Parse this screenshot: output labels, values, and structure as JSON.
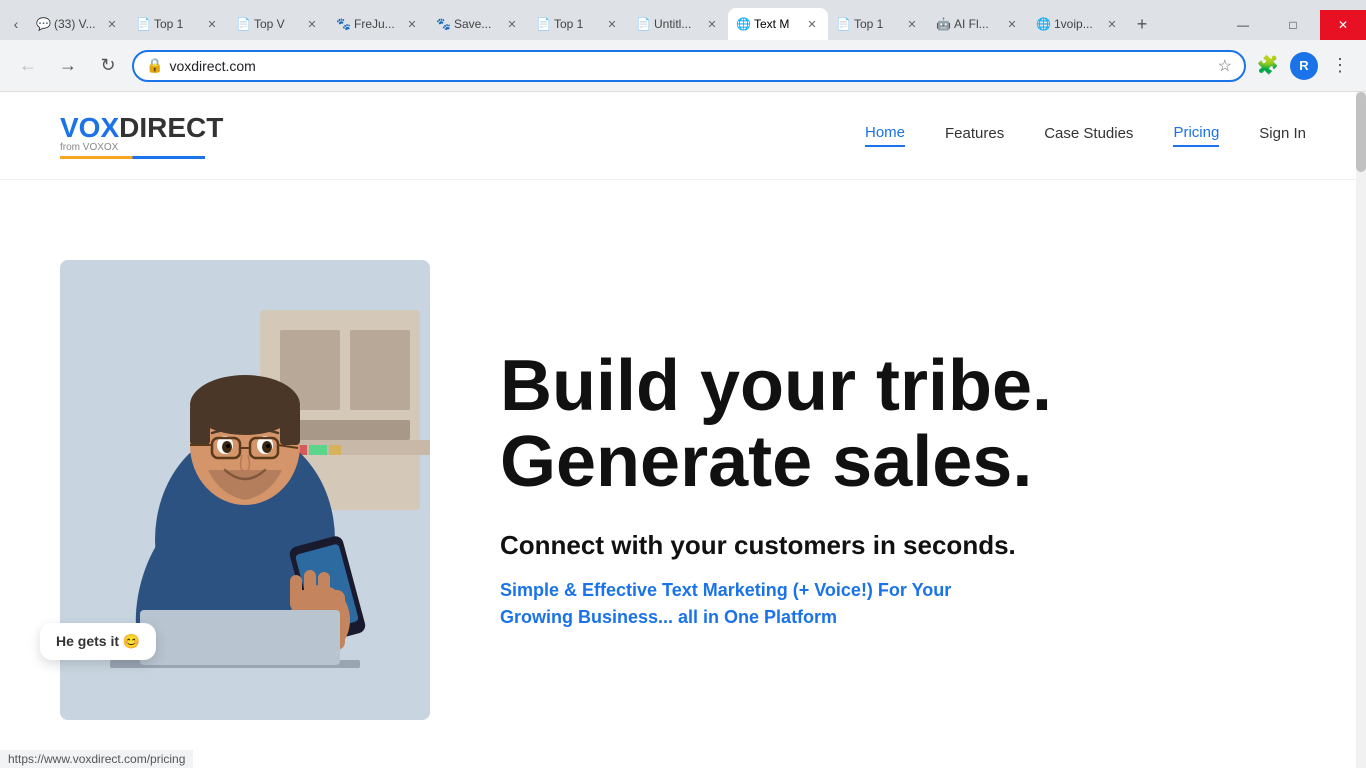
{
  "browser": {
    "tabs": [
      {
        "id": "tab1",
        "favicon": "💬",
        "title": "(33) V...",
        "active": false,
        "favicon_color": "green"
      },
      {
        "id": "tab2",
        "favicon": "📄",
        "title": "Top 1",
        "active": false,
        "favicon_color": "blue"
      },
      {
        "id": "tab3",
        "favicon": "📄",
        "title": "Top V",
        "active": false,
        "favicon_color": "blue"
      },
      {
        "id": "tab4",
        "favicon": "🐾",
        "title": "FreJu...",
        "active": false,
        "favicon_color": "orange"
      },
      {
        "id": "tab5",
        "favicon": "🐾",
        "title": "Save...",
        "active": false,
        "favicon_color": "orange"
      },
      {
        "id": "tab6",
        "favicon": "📄",
        "title": "Top 1",
        "active": false,
        "favicon_color": "blue"
      },
      {
        "id": "tab7",
        "favicon": "📄",
        "title": "Untitl...",
        "active": false,
        "favicon_color": "gray"
      },
      {
        "id": "tab8",
        "favicon": "🌐",
        "title": "Text M",
        "active": true,
        "favicon_color": "blue"
      },
      {
        "id": "tab9",
        "favicon": "📄",
        "title": "Top 1",
        "active": false,
        "favicon_color": "blue"
      },
      {
        "id": "tab10",
        "favicon": "🤖",
        "title": "AI Fl...",
        "active": false,
        "favicon_color": "purple"
      },
      {
        "id": "tab11",
        "favicon": "🌐",
        "title": "1voip...",
        "active": false,
        "favicon_color": "blue"
      }
    ],
    "address": "voxdirect.com",
    "back_disabled": true,
    "profile_letter": "R"
  },
  "site": {
    "logo": {
      "vox": "VOX",
      "direct": "DIRECT",
      "sub": "from VOXOX",
      "underline_color": "#f5a623"
    },
    "nav": {
      "links": [
        {
          "label": "Home",
          "active": true
        },
        {
          "label": "Features",
          "active": false
        },
        {
          "label": "Case Studies",
          "active": false
        },
        {
          "label": "Pricing",
          "active": false
        },
        {
          "label": "Sign In",
          "active": false
        }
      ]
    },
    "hero": {
      "headline_line1": "Build your tribe.",
      "headline_line2": "Generate sales.",
      "subtext": "Connect with your customers in seconds.",
      "description_line1": "Simple & Effective Text Marketing (+ Voice!) For Your",
      "description_line2": "Growing Business... all in One Platform",
      "speech_bubble": "He gets it 😊"
    }
  },
  "status_bar": {
    "url": "https://www.voxdirect.com/pricing"
  },
  "window_controls": {
    "minimize": "—",
    "maximize": "□",
    "close": "✕"
  }
}
